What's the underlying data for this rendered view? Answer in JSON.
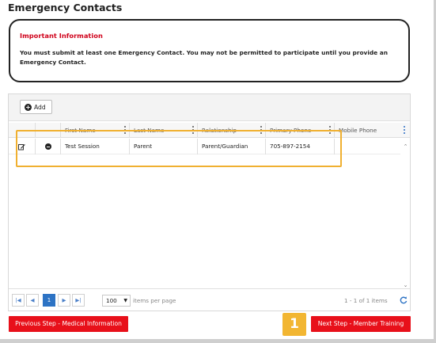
{
  "page": {
    "title": "Emergency Contacts"
  },
  "info": {
    "heading": "Important Information",
    "message": "You must submit at least one Emergency Contact.  You may not be permitted to participate until you provide an Emergency Contact."
  },
  "toolbar": {
    "add_label": "Add"
  },
  "grid": {
    "columns": [
      "First Name",
      "Last Name",
      "Relationship",
      "Primary Phone",
      "Mobile Phone"
    ],
    "rows": [
      {
        "first_name": "Test Session",
        "last_name": "Parent",
        "relationship": "Parent/Guardian",
        "primary_phone": "705-897-2154",
        "mobile_phone": ""
      }
    ]
  },
  "pager": {
    "first_icon": "first-page-icon",
    "prev_icon": "prev-page-icon",
    "current_page": "1",
    "next_icon": "next-page-icon",
    "last_icon": "last-page-icon",
    "page_size": "100",
    "per_page_label": "items per page",
    "range_label": "1 - 1 of 1 items"
  },
  "footer": {
    "prev_label": "Previous Step - Medical Information",
    "next_label": "Next Step - Member Training",
    "step_badge": "1"
  },
  "colors": {
    "accent_red": "#e8101a",
    "highlight": "#f0b030",
    "badge": "#f2b632",
    "pager_active": "#2d73c4"
  }
}
